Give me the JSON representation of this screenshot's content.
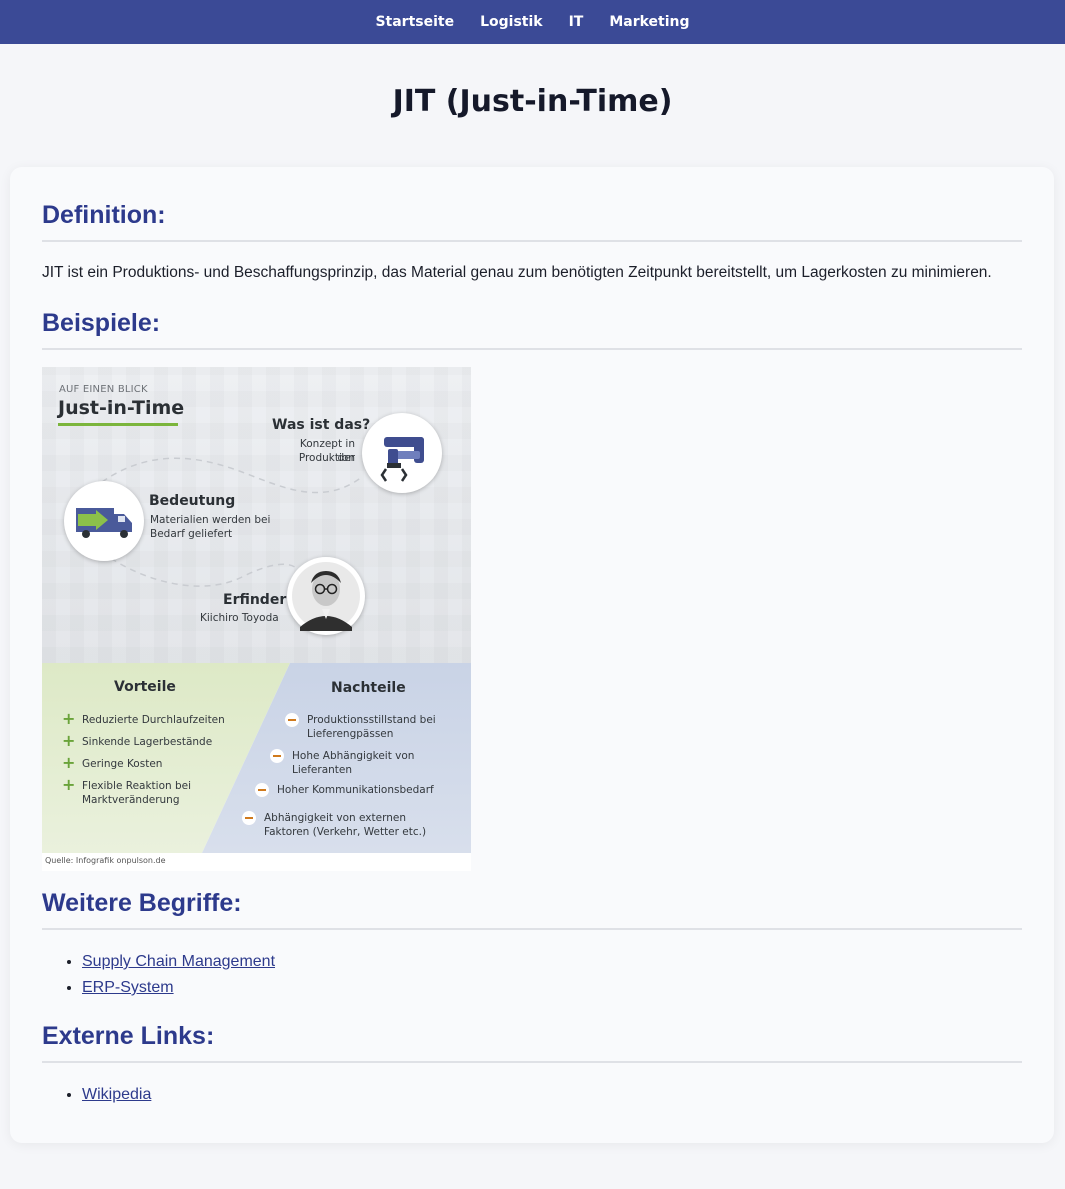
{
  "nav": {
    "items": [
      {
        "label": "Startseite"
      },
      {
        "label": "Logistik"
      },
      {
        "label": "IT"
      },
      {
        "label": "Marketing"
      }
    ]
  },
  "page": {
    "title": "JIT (Just-in-Time)"
  },
  "definition": {
    "heading": "Definition:",
    "text": "JIT ist ein Produktions- und Beschaffungsprinzip, das Material genau zum benötigten Zeitpunkt bereitstellt, um Lagerkosten zu minimieren."
  },
  "examples": {
    "heading": "Beispiele:",
    "infographic": {
      "kicker": "AUF EINEN BLICK",
      "title": "Just-in-Time",
      "what": {
        "heading": "Was ist das?",
        "text1": "Konzept in der",
        "text2": "Produktion"
      },
      "meaning": {
        "heading": "Bedeutung",
        "text1": "Materialien werden bei",
        "text2": "Bedarf geliefert"
      },
      "inventor": {
        "heading": "Erfinder",
        "text": "Kiichiro Toyoda"
      },
      "advantages": {
        "heading": "Vorteile",
        "items": [
          {
            "line1": "Reduzierte Durchlaufzeiten",
            "line2": ""
          },
          {
            "line1": "Sinkende Lagerbestände",
            "line2": ""
          },
          {
            "line1": "Geringe Kosten",
            "line2": ""
          },
          {
            "line1": "Flexible Reaktion bei",
            "line2": "Marktveränderung"
          }
        ]
      },
      "disadvantages": {
        "heading": "Nachteile",
        "items": [
          {
            "line1": "Produktionsstillstand bei",
            "line2": "Lieferengpässen"
          },
          {
            "line1": "Hohe Abhängigkeit von",
            "line2": "Lieferanten"
          },
          {
            "line1": "Hoher Kommunikationsbedarf",
            "line2": ""
          },
          {
            "line1": "Abhängigkeit von externen",
            "line2": "Faktoren (Verkehr, Wetter etc.)"
          }
        ]
      },
      "source": "Quelle: Infografik onpulson.de",
      "colors": {
        "green": "#7bb53c",
        "orange": "#d07a1d"
      }
    }
  },
  "further_terms": {
    "heading": "Weitere Begriffe:",
    "links": [
      {
        "label": "Supply Chain Management"
      },
      {
        "label": "ERP-System"
      }
    ]
  },
  "external_links": {
    "heading": "Externe Links:",
    "links": [
      {
        "label": "Wikipedia"
      }
    ]
  }
}
